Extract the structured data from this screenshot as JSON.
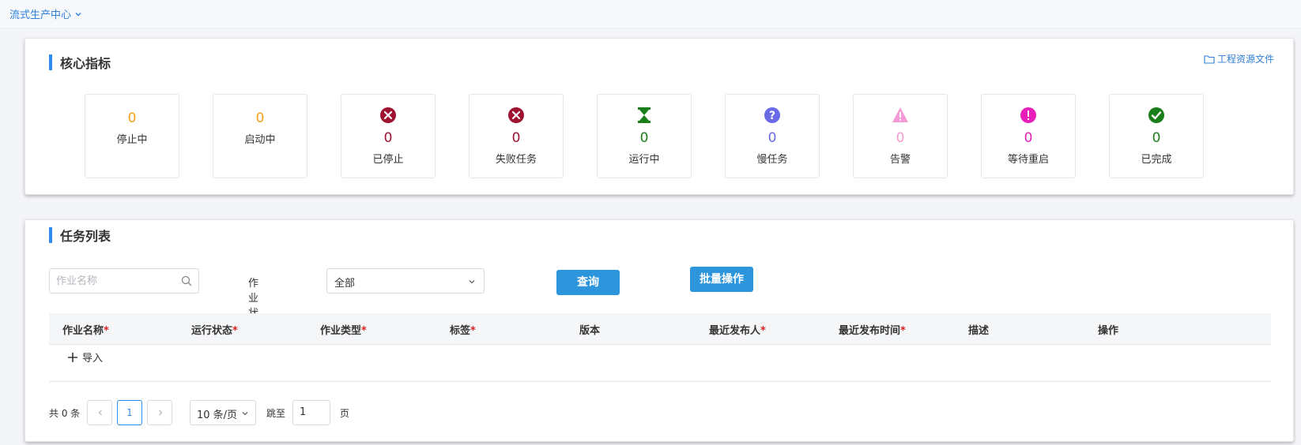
{
  "topbar": {
    "center_name": "流式生产中心"
  },
  "metrics_card": {
    "title": "核心指标",
    "resource_link": "工程资源文件",
    "items": [
      {
        "label": "停止中",
        "value": "0",
        "color": "#f2a21b",
        "icon": "none"
      },
      {
        "label": "启动中",
        "value": "0",
        "color": "#f2a21b",
        "icon": "none"
      },
      {
        "label": "已停止",
        "value": "0",
        "color": "#9e1232",
        "icon": "x-circle-icon"
      },
      {
        "label": "失败任务",
        "value": "0",
        "color": "#9e1232",
        "icon": "x-circle-icon"
      },
      {
        "label": "运行中",
        "value": "0",
        "color": "#1a7f1a",
        "icon": "hourglass-icon"
      },
      {
        "label": "慢任务",
        "value": "0",
        "color": "#6a6ae6",
        "icon": "question-circle-icon"
      },
      {
        "label": "告警",
        "value": "0",
        "color": "#f59ad4",
        "icon": "warning-triangle-icon"
      },
      {
        "label": "等待重启",
        "value": "0",
        "color": "#e81fb8",
        "icon": "exclamation-circle-icon"
      },
      {
        "label": "已完成",
        "value": "0",
        "color": "#1a7f1a",
        "icon": "check-circle-icon"
      }
    ]
  },
  "tasks_card": {
    "title": "任务列表",
    "search": {
      "placeholder": "作业名称"
    },
    "status_filter": {
      "label": "作业状态",
      "value": "全部"
    },
    "query_button": "查询",
    "batch_button": "批量操作",
    "columns": [
      {
        "label": "作业名称",
        "required": "*"
      },
      {
        "label": "运行状态",
        "required": "*"
      },
      {
        "label": "作业类型",
        "required": "*"
      },
      {
        "label": "标签",
        "required": "*"
      },
      {
        "label": "版本",
        "required": ""
      },
      {
        "label": "最近发布人",
        "required": "*"
      },
      {
        "label": "最近发布时间",
        "required": "*"
      },
      {
        "label": "描述",
        "required": ""
      },
      {
        "label": "操作",
        "required": ""
      }
    ],
    "import_label": "导入",
    "pagination": {
      "total": "共 0 条",
      "current_page": "1",
      "page_size": "10 条/页",
      "jump_label": "跳至",
      "jump_value": "1",
      "page_suffix": "页"
    }
  },
  "colors": {
    "accent": "#2f8cf0",
    "button": "#2d95dc",
    "link": "#2f7fd6"
  }
}
